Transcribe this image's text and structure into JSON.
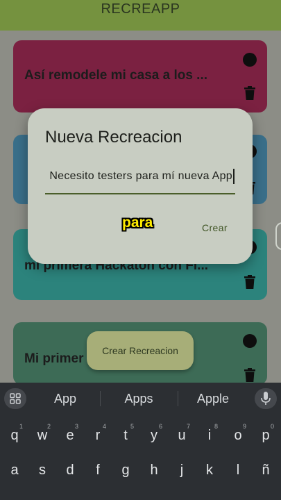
{
  "appbar": {
    "title": "RECREAPP"
  },
  "cards": [
    {
      "title": "Así remodele mi casa a los ..."
    },
    {
      "title": ""
    },
    {
      "title": "mi primera Hackaton con Fl..."
    },
    {
      "title": "Mi primer ... ck..."
    }
  ],
  "dialog": {
    "title": "Nueva Recreacion",
    "input_value": "Necesito testers para mí nueva App",
    "create_label": "Crear"
  },
  "caption": "para",
  "fab_label": "Crear Recreacion",
  "keyboard": {
    "suggestions": [
      "App",
      "Apps",
      "Apple"
    ],
    "row1": [
      {
        "k": "q",
        "alt": "1"
      },
      {
        "k": "w",
        "alt": "2"
      },
      {
        "k": "e",
        "alt": "3"
      },
      {
        "k": "r",
        "alt": "4"
      },
      {
        "k": "t",
        "alt": "5"
      },
      {
        "k": "y",
        "alt": "6"
      },
      {
        "k": "u",
        "alt": "7"
      },
      {
        "k": "i",
        "alt": "8"
      },
      {
        "k": "o",
        "alt": "9"
      },
      {
        "k": "p",
        "alt": "0"
      }
    ],
    "row2": [
      "a",
      "s",
      "d",
      "f",
      "g",
      "h",
      "j",
      "k",
      "l",
      "ñ"
    ]
  },
  "colors": {
    "appbar": "#75923f",
    "card1": "#7b2141",
    "card2": "#3a6f8a",
    "card3": "#2c837c",
    "card4": "#3d6b56",
    "dialog": "#c8cdc2",
    "caption": "#ffec00"
  }
}
